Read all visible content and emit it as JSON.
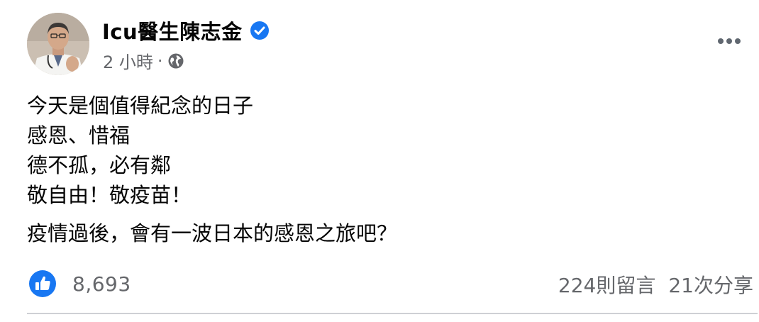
{
  "post": {
    "author": "Icu醫生陳志金",
    "time": "2 小時",
    "separator": "·",
    "body_lines": [
      "今天是個值得紀念的日子",
      "感恩、惜福",
      "德不孤，必有鄰",
      "敬自由！敬疫苗！"
    ],
    "body_paragraph2": "疫情過後，會有一波日本的感恩之旅吧？",
    "reactions_count": "8,693",
    "comments": "224則留言",
    "shares": "21次分享"
  },
  "icons": {
    "verified": "verified-badge-icon",
    "audience": "globe-icon",
    "more": "more-options-icon",
    "reaction": "like-icon"
  },
  "colors": {
    "facebook_blue": "#1877F2",
    "secondary_text": "#65676B",
    "primary_text": "#050505",
    "divider": "#CED0D4"
  }
}
